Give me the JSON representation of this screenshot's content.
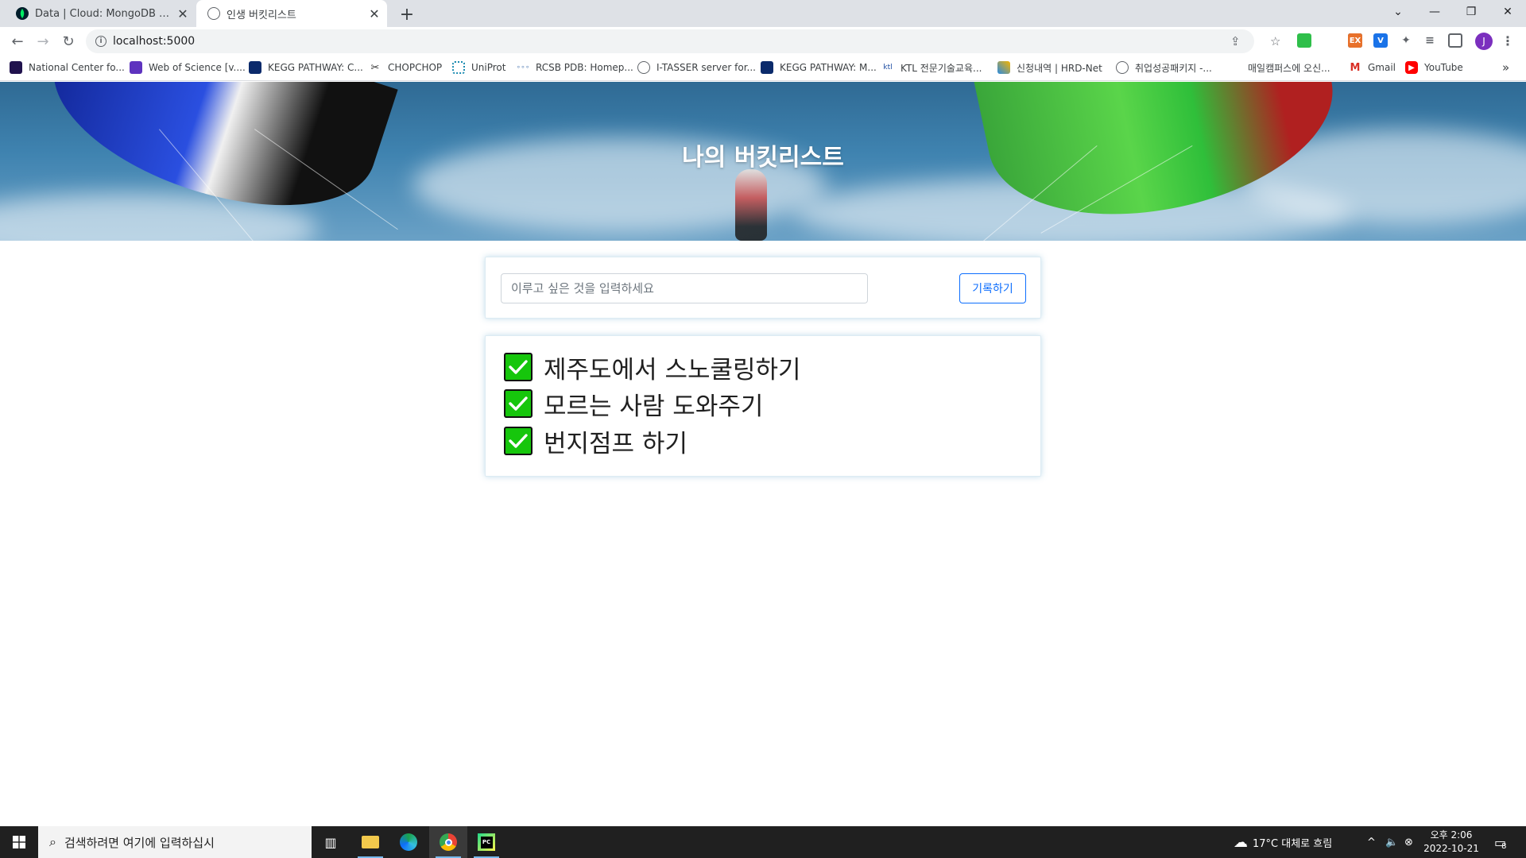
{
  "browser": {
    "tabs": [
      {
        "title": "Data | Cloud: MongoDB Cloud",
        "icon": "mongodb-leaf-icon",
        "active": false
      },
      {
        "title": "인생 버킷리스트",
        "icon": "globe-icon",
        "active": true
      }
    ],
    "url": "localhost:5000",
    "profile_initial": "J",
    "bookmarks": [
      {
        "label": "National Center fo...",
        "icon": "ncbi-icon"
      },
      {
        "label": "Web of Science [v....",
        "icon": "clarivate-icon"
      },
      {
        "label": "KEGG PATHWAY: C...",
        "icon": "kegg-icon"
      },
      {
        "label": "CHOPCHOP",
        "icon": "chopchop-icon"
      },
      {
        "label": "UniProt",
        "icon": "uniprot-icon"
      },
      {
        "label": "RCSB PDB: Homep...",
        "icon": "pdb-icon"
      },
      {
        "label": "I-TASSER server for...",
        "icon": "globe-icon"
      },
      {
        "label": "KEGG PATHWAY: M...",
        "icon": "kegg-icon"
      },
      {
        "label": "KTL 전문기술교육...",
        "icon": "ktl-icon"
      },
      {
        "label": "신청내역 | HRD-Net",
        "icon": "hrdnet-icon"
      },
      {
        "label": "취업성공패키지 -...",
        "icon": "globe-icon"
      },
      {
        "label": "매일캠퍼스에 오신...",
        "icon": "blank-icon"
      },
      {
        "label": "Gmail",
        "icon": "gmail-icon"
      },
      {
        "label": "YouTube",
        "icon": "youtube-icon"
      }
    ],
    "overflow_label": "»"
  },
  "page": {
    "title": "나의 버킷리스트",
    "input_placeholder": "이루고 싶은 것을 입력하세요",
    "save_label": "기록하기",
    "items": [
      {
        "text": "제주도에서 스노쿨링하기",
        "done": true
      },
      {
        "text": "모르는 사람 도와주기",
        "done": true
      },
      {
        "text": "번지점프 하기",
        "done": true
      }
    ]
  },
  "taskbar": {
    "search_placeholder": "검색하려면 여기에 입력하십시",
    "weather": "17°C  대체로 흐림",
    "time": "오후 2:06",
    "date": "2022-10-21",
    "notification_count": "8"
  },
  "colors": {
    "accent": "#0d6efd",
    "check_green": "#16c60c",
    "taskbar": "#202020"
  }
}
